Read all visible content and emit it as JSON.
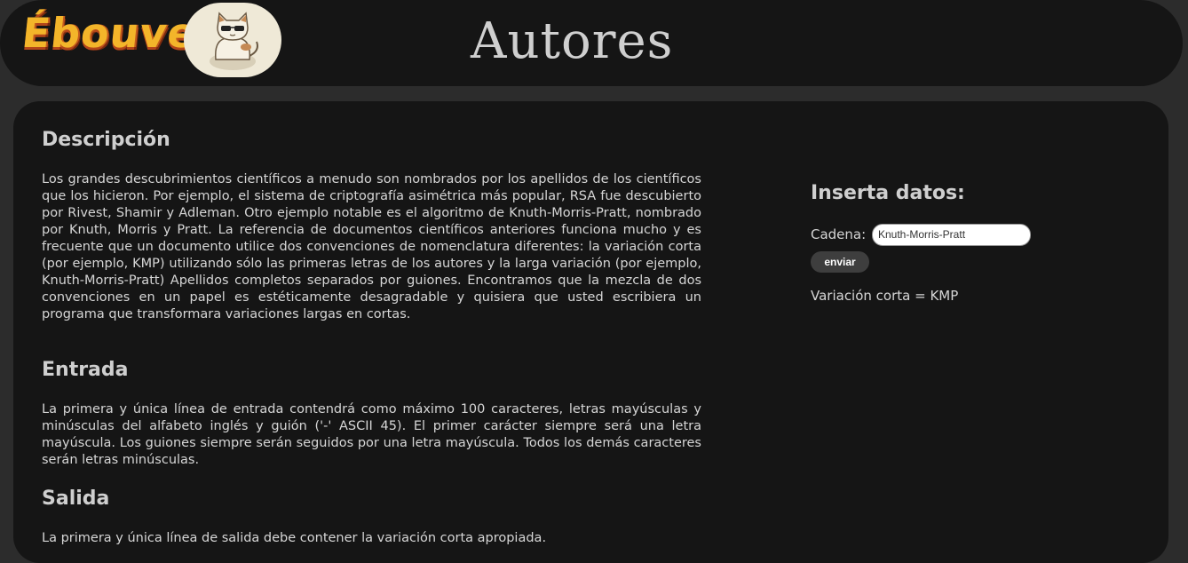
{
  "header": {
    "logo_text": "Ébouveur",
    "title": "Autores"
  },
  "sections": {
    "descripcion": {
      "heading": "Descripción",
      "body": "Los grandes descubrimientos científicos a menudo son nombrados por los apellidos de los científicos que los hicieron. Por ejemplo, el sistema de criptografía asimétrica más popular, RSA fue descubierto por Rivest, Shamir y Adleman. Otro ejemplo notable es el algoritmo de Knuth-Morris-Pratt, nombrado por Knuth, Morris y Pratt. La referencia de documentos científicos anteriores funciona mucho y es frecuente que un documento utilice dos convenciones de nomenclatura diferentes: la variación corta (por ejemplo, KMP) utilizando sólo las primeras letras de los autores y la larga variación (por ejemplo, Knuth-Morris-Pratt) Apellidos completos separados por guiones. Encontramos que la mezcla de dos convenciones en un papel es estéticamente desagradable y quisiera que usted escribiera un programa que transformara variaciones largas en cortas."
    },
    "entrada": {
      "heading": "Entrada",
      "body": "La primera y única línea de entrada contendrá como máximo 100 caracteres, letras mayúsculas y minúsculas del alfabeto inglés y guión ('-' ASCII 45). El primer carácter siempre será una letra mayúscula. Los guiones siempre serán seguidos por una letra mayúscula. Todos los demás caracteres serán letras minúsculas."
    },
    "salida": {
      "heading": "Salida",
      "body": "La primera y única línea de salida debe contener la variación corta apropiada."
    }
  },
  "form": {
    "heading": "Inserta datos:",
    "label": "Cadena:",
    "value": "Knuth-Morris-Pratt",
    "button": "enviar",
    "result": "Variación corta = KMP"
  }
}
